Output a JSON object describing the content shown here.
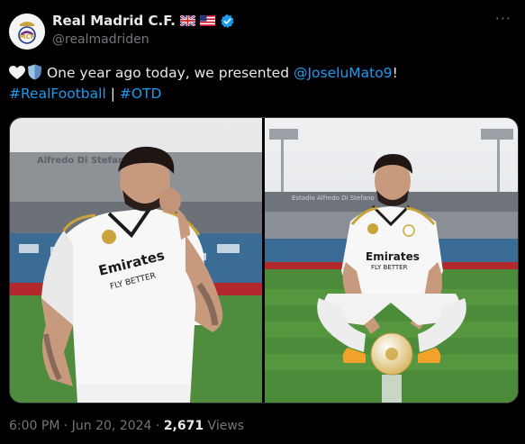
{
  "author": {
    "display_name": "Real Madrid C.F.",
    "handle": "@realmadriden",
    "flags": [
      "uk-flag",
      "us-flag"
    ]
  },
  "tweet": {
    "text_before": "One year ago today, we presented ",
    "mention": "@JoseluMato9",
    "text_after": "!",
    "hashtag1": "#RealFootball",
    "separator": " | ",
    "hashtag2": "#OTD"
  },
  "media": {
    "left_stadium_sign": "Alfredo Di Stefano",
    "right_stadium_sign": "Estadio Alfredo Di Stefano",
    "jersey_sponsor_line1": "Emirates",
    "jersey_sponsor_line2": "FLY BETTER"
  },
  "meta": {
    "time": "6:00 PM",
    "dot1": " · ",
    "date": "Jun 20, 2024",
    "dot2": " · ",
    "views_count": "2,671",
    "views_label": " Views"
  },
  "colors": {
    "background": "#000000",
    "text": "#e7e9ea",
    "secondary": "#71767b",
    "link": "#1d9bf0",
    "verified": "#1d9bf0"
  }
}
